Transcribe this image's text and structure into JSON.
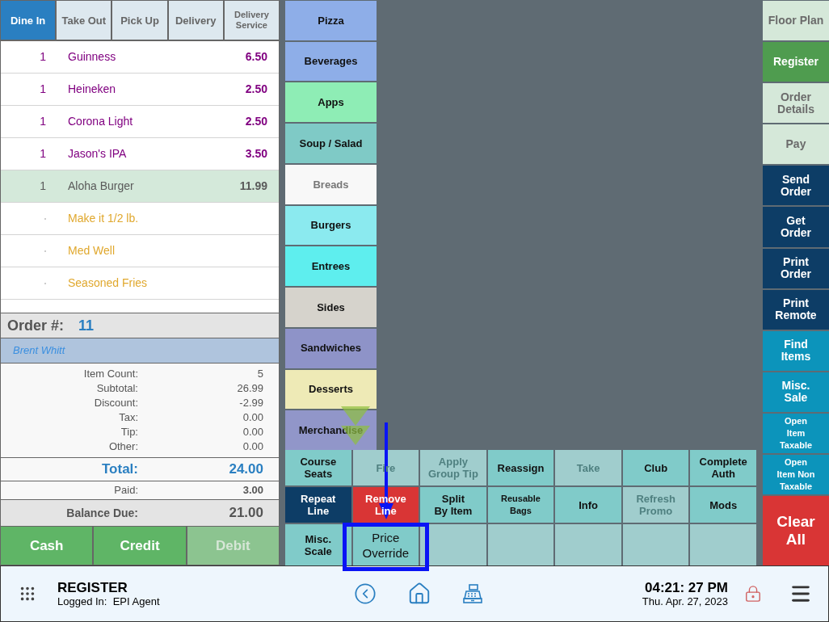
{
  "order_types": [
    {
      "label": "Dine In",
      "selected": true
    },
    {
      "label": "Take Out",
      "selected": false
    },
    {
      "label": "Pick Up",
      "selected": false
    },
    {
      "label": "Delivery",
      "selected": false
    },
    {
      "label": "Delivery Service",
      "selected": false
    }
  ],
  "order_lines": [
    {
      "kind": "item",
      "qty": "1",
      "name": "Guinness",
      "price": "6.50",
      "color": "#800080",
      "selected": false
    },
    {
      "kind": "item",
      "qty": "1",
      "name": "Heineken",
      "price": "2.50",
      "color": "#800080",
      "selected": false
    },
    {
      "kind": "item",
      "qty": "1",
      "name": "Corona Light",
      "price": "2.50",
      "color": "#800080",
      "selected": false
    },
    {
      "kind": "item",
      "qty": "1",
      "name": "Jason's IPA",
      "price": "3.50",
      "color": "#800080",
      "selected": false
    },
    {
      "kind": "item",
      "qty": "1",
      "name": "Aloha Burger",
      "price": "11.99",
      "color": "#5a5a5a",
      "selected": true
    },
    {
      "kind": "modifier",
      "name": "Make it 1/2 lb."
    },
    {
      "kind": "modifier",
      "name": "Med Well"
    },
    {
      "kind": "modifier",
      "name": "Seasoned Fries"
    }
  ],
  "order": {
    "label": "Order #:",
    "number": "11"
  },
  "customer": "Brent Whitt",
  "summary": [
    {
      "label": "Item Count:",
      "value": "5"
    },
    {
      "label": "Subtotal:",
      "value": "26.99"
    },
    {
      "label": "Discount:",
      "value": "-2.99"
    },
    {
      "label": "Tax:",
      "value": "0.00"
    },
    {
      "label": "Tip:",
      "value": "0.00"
    },
    {
      "label": "Other:",
      "value": "0.00"
    }
  ],
  "total": {
    "label": "Total:",
    "value": "24.00"
  },
  "paid": {
    "label": "Paid:",
    "value": "3.00"
  },
  "balance_due": {
    "label": "Balance Due:",
    "value": "21.00"
  },
  "payment_buttons": [
    {
      "label": "Cash",
      "disabled": false
    },
    {
      "label": "Credit",
      "disabled": false
    },
    {
      "label": "Debit",
      "disabled": true
    }
  ],
  "categories": [
    {
      "label": "Pizza",
      "color": "#8eaee8",
      "disabled": false
    },
    {
      "label": "Beverages",
      "color": "#8eaee8",
      "disabled": false
    },
    {
      "label": "Apps",
      "color": "#8eedb5",
      "disabled": false
    },
    {
      "label": "Soup / Salad",
      "color": "#7fcac6",
      "disabled": false
    },
    {
      "label": "Breads",
      "color": "#f8f8f8",
      "disabled": true
    },
    {
      "label": "Burgers",
      "color": "#8beaef",
      "disabled": false
    },
    {
      "label": "Entrees",
      "color": "#5eeeee",
      "disabled": false
    },
    {
      "label": "Sides",
      "color": "#d6d3cc",
      "disabled": false
    },
    {
      "label": "Sandwiches",
      "color": "#8e93c8",
      "disabled": false
    },
    {
      "label": "Desserts",
      "color": "#eeeab6",
      "disabled": false
    },
    {
      "label": "Merchandise",
      "color": "#9196c9",
      "disabled": false
    }
  ],
  "categories_more_below": true,
  "function_buttons": [
    {
      "kind": "normal",
      "label": "Course\nSeats",
      "disabled": false,
      "highlighted": false
    },
    {
      "kind": "normal",
      "label": "Fire",
      "disabled": true,
      "highlighted": false
    },
    {
      "kind": "normal",
      "label": "Apply\nGroup Tip",
      "disabled": true,
      "highlighted": false
    },
    {
      "kind": "normal",
      "label": "Reassign",
      "disabled": false,
      "highlighted": false
    },
    {
      "kind": "normal",
      "label": "Take",
      "disabled": true,
      "highlighted": false
    },
    {
      "kind": "normal",
      "label": "Club",
      "disabled": false,
      "highlighted": false
    },
    {
      "kind": "normal",
      "label": "Complete\nAuth",
      "disabled": false,
      "highlighted": false
    },
    {
      "kind": "dark",
      "label": "Repeat\nLine",
      "disabled": false,
      "highlighted": false
    },
    {
      "kind": "danger",
      "label": "Remove\nLine",
      "disabled": false,
      "highlighted": false
    },
    {
      "kind": "normal",
      "label": "Split\nBy Item",
      "disabled": false,
      "highlighted": false
    },
    {
      "kind": "small",
      "label": "Reusable\nBags",
      "disabled": false,
      "highlighted": false
    },
    {
      "kind": "normal",
      "label": "Info",
      "disabled": false,
      "highlighted": false
    },
    {
      "kind": "normal",
      "label": "Refresh\nPromo",
      "disabled": true,
      "highlighted": false
    },
    {
      "kind": "normal",
      "label": "Mods",
      "disabled": false,
      "highlighted": false
    },
    {
      "kind": "normal",
      "label": "Misc.\nScale",
      "disabled": false,
      "highlighted": false
    },
    {
      "kind": "normal",
      "label": "Price\nOverride",
      "disabled": false,
      "highlighted": true
    },
    {
      "kind": "empty"
    },
    {
      "kind": "empty"
    },
    {
      "kind": "empty"
    },
    {
      "kind": "empty"
    },
    {
      "kind": "empty"
    }
  ],
  "side_buttons": [
    {
      "kind": "light",
      "label": "Floor Plan"
    },
    {
      "kind": "active",
      "label": "Register"
    },
    {
      "kind": "light",
      "label": "Order\nDetails"
    },
    {
      "kind": "light",
      "label": "Pay"
    },
    {
      "kind": "navy",
      "label": "Send\nOrder"
    },
    {
      "kind": "navy",
      "label": "Get\nOrder"
    },
    {
      "kind": "navy",
      "label": "Print\nOrder"
    },
    {
      "kind": "navy",
      "label": "Print\nRemote"
    },
    {
      "kind": "teal",
      "label": "Find\nItems"
    },
    {
      "kind": "teal",
      "label": "Misc.\nSale"
    },
    {
      "kind": "teal-small",
      "label": "Open\nItem\nTaxable"
    },
    {
      "kind": "teal-small",
      "label": "Open\nItem Non\nTaxable"
    },
    {
      "kind": "danger",
      "label": "Clear\nAll"
    }
  ],
  "status_bar": {
    "screen_title": "REGISTER",
    "logged_in": "Logged In:  EPI Agent",
    "time": "04:21: 27 PM",
    "date": "Thu. Apr. 27, 2023"
  }
}
